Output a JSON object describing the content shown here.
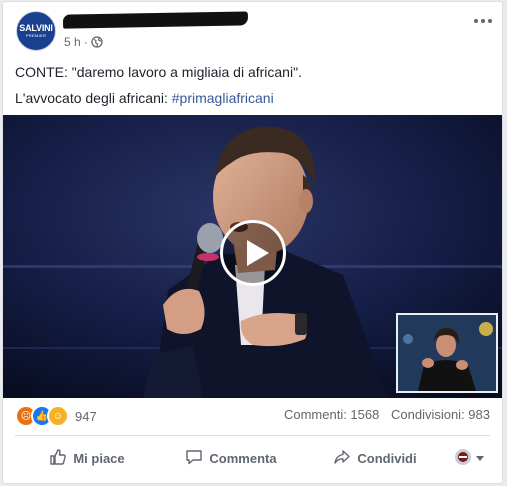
{
  "page": {
    "avatar": {
      "name": "SALVINI",
      "sub": "PREMIER"
    },
    "time": "5 h",
    "separator": "·"
  },
  "post": {
    "line1": "CONTE: \"daremo lavoro a migliaia di africani\".",
    "line2_prefix": "L'avvocato degli africani: ",
    "hashtag": "#primagliafricani"
  },
  "reactions": {
    "icons": [
      "angry-icon",
      "like-icon",
      "haha-icon"
    ],
    "count": "947"
  },
  "counts": {
    "comments": "Commenti: 1568",
    "shares": "Condivisioni: 983"
  },
  "actions": {
    "like": "Mi piace",
    "comment": "Commenta",
    "share": "Condividi"
  },
  "colors": {
    "link": "#385898",
    "text": "#1d2129",
    "muted": "#606770",
    "avatar_bg": "#1b3f8f"
  }
}
